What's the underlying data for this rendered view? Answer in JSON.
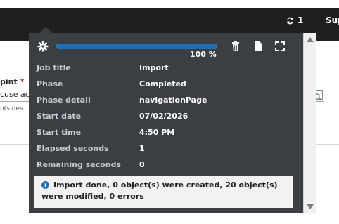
{
  "topbar": {
    "sync_count": "1",
    "sup_text": "Sup"
  },
  "background": {
    "field_label": "pint",
    "required_mark": "*",
    "input_value": "cuse ac",
    "help_text": "nts des"
  },
  "job": {
    "progress_percent": 100,
    "progress_label": "100 %",
    "rows": [
      {
        "key": "Job title",
        "value": "Import"
      },
      {
        "key": "Phase",
        "value": "Completed"
      },
      {
        "key": "Phase detail",
        "value": "navigationPage"
      },
      {
        "key": "Start date",
        "value": "07/02/2026"
      },
      {
        "key": "Start time",
        "value": "4:50 PM"
      },
      {
        "key": "Elapsed seconds",
        "value": "1"
      },
      {
        "key": "Remaining seconds",
        "value": "0"
      }
    ],
    "message": "Import done, 0 object(s) were created, 20 object(s) were modified, 0 errors"
  },
  "colors": {
    "popover_bg": "#3b3e43",
    "progress_fill": "#1f6fb8",
    "topbar_bg": "#1f1f1f"
  }
}
